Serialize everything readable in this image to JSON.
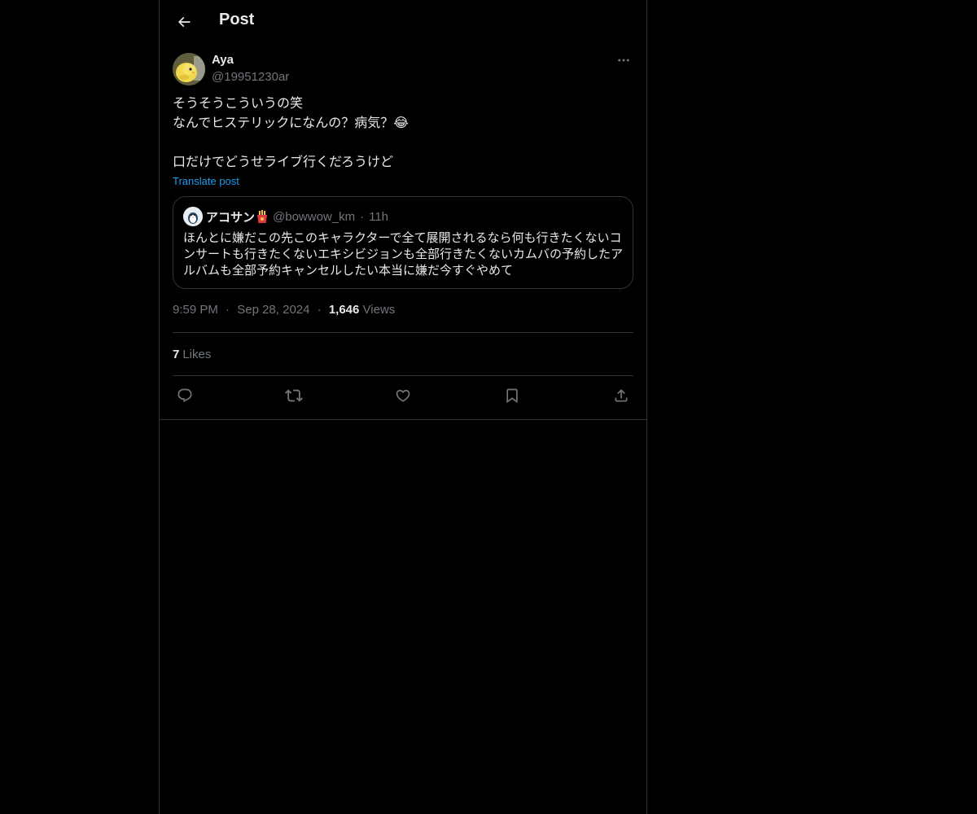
{
  "header": {
    "title": "Post",
    "back_icon": "arrow-left-icon"
  },
  "post": {
    "author": {
      "name": "Aya",
      "handle": "@19951230ar",
      "avatar_icon": "chick-avatar"
    },
    "text_lines": [
      "そうそうこういうの笑",
      "なんでヒステリックになんの？病気？😂",
      "",
      "口だけでどうせライブ行くだろうけど"
    ],
    "translate_label": "Translate post",
    "quote": {
      "name": "アコサン",
      "name_emoji": "fries-icon",
      "handle": "@bowwow_km",
      "dot": "·",
      "time": "11h",
      "text": "ほんとに嫌だこの先このキャラクターで全て展開されるなら何も行きたくないコンサートも行きたくないエキシビジョンも全部行きたくないカムバの予約したアルバムも全部予約キャンセルしたい本当に嫌だ今すぐやめて"
    },
    "meta": {
      "time": "9:59 PM",
      "sep1": "·",
      "date": "Sep 28, 2024",
      "sep2": "·",
      "views_count": "1,646",
      "views_label": "Views"
    },
    "likes": {
      "count": "7",
      "label": "Likes"
    }
  },
  "actions": [
    "reply-icon",
    "repost-icon",
    "like-icon",
    "bookmark-icon",
    "share-icon"
  ],
  "colors": {
    "background": "#000000",
    "text": "#e7e9ea",
    "muted": "#71767b",
    "link": "#1d9bf0",
    "border": "#2f3336"
  }
}
